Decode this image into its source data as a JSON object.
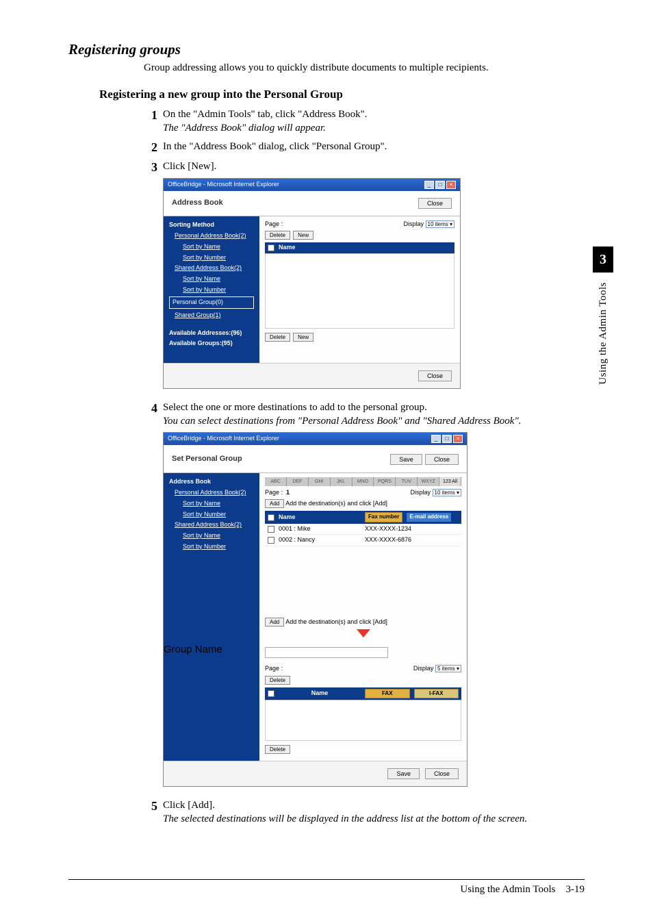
{
  "headings": {
    "h1": "Registering groups",
    "intro": "Group addressing allows you to quickly distribute documents to multiple recipients.",
    "h2": "Registering a new group into the Personal Group"
  },
  "steps": {
    "s1a": "On the \"Admin Tools\" tab, click \"Address Book\".",
    "s1b": "The \"Address Book\" dialog will appear.",
    "s2": "In the \"Address Book\" dialog, click \"Personal Group\".",
    "s3": "Click [New].",
    "s4a": "Select the one or more destinations to add to the personal group.",
    "s4b": "You can select destinations from \"Personal Address Book\" and \"Shared Address Book\".",
    "s5a": "Click [Add].",
    "s5b": "The selected destinations will be displayed in the address list at the bottom of the screen."
  },
  "screenshot1": {
    "windowTitle": "OfficeBridge - Microsoft Internet Explorer",
    "headerTitle": "Address Book",
    "close": "Close",
    "sorting": "Sorting Method",
    "pab": "Personal Address Book(2)",
    "sortName": "Sort by Name",
    "sortNum": "Sort by Number",
    "sab": "Shared Address Book(2)",
    "pg": "Personal Group(0)",
    "sg": "Shared Group(1)",
    "availAddr": "Available Addresses:(96)",
    "availGroup": "Available Groups:(95)",
    "page": "Page :",
    "display": "Display",
    "items10": "10 items",
    "delete": "Delete",
    "new": "New",
    "name": "Name"
  },
  "screenshot2": {
    "windowTitle": "OfficeBridge - Microsoft Internet Explorer",
    "headerTitle": "Set Personal Group",
    "save": "Save",
    "close": "Close",
    "addressBook": "Address Book",
    "pab": "Personal Address Book(2)",
    "sortName": "Sort by Name",
    "sortNum": "Sort by Number",
    "sab": "Shared Address Book(2)",
    "page": "Page :",
    "page1": "1",
    "display": "Display",
    "items10": "10 items",
    "add": "Add",
    "addHint": "Add the destination(s) and click [Add]",
    "name": "Name",
    "faxNumber": "Fax number",
    "emailAddr": "E-mail address",
    "row1id": "0001 : Mike",
    "row1fax": "XXX-XXXX-1234",
    "row2id": "0002 : Nancy",
    "row2fax": "XXX-XXXX-6876",
    "groupName": "Group Name",
    "items5": "5 items",
    "delete": "Delete",
    "fax": "FAX",
    "ifax": "I-FAX",
    "alpha": [
      "ABC",
      "DEF",
      "GHI",
      "JKL",
      "MNO",
      "PQRS",
      "TUV",
      "WXYZ",
      "123 All"
    ]
  },
  "sideTab": {
    "num": "3",
    "text": "Using the Admin Tools"
  },
  "footer": {
    "title": "Using the Admin Tools",
    "page": "3-19"
  }
}
